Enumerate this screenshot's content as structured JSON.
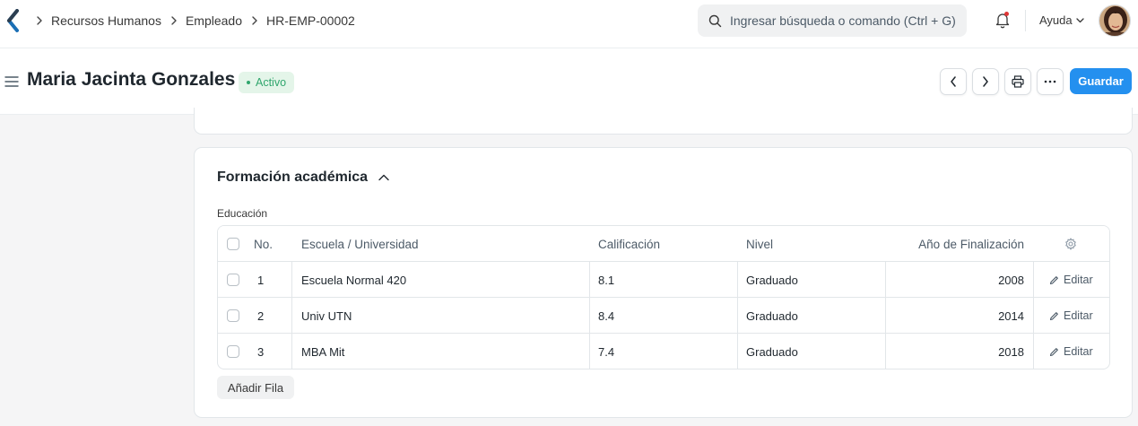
{
  "navbar": {
    "breadcrumbs": [
      "Recursos Humanos",
      "Empleado",
      "HR-EMP-00002"
    ],
    "search_placeholder": "Ingresar búsqueda o comando (Ctrl + G)",
    "help_label": "Ayuda",
    "icons": [
      "app-logo-icon",
      "chevron-right-icon",
      "search-icon",
      "bell-icon",
      "chevron-down-icon"
    ],
    "accent_color": "#2490ef",
    "notification_dot_color": "#e03636"
  },
  "page_head": {
    "title": "Maria Jacinta Gonzales",
    "status": "Activo",
    "status_color": "#30a66d",
    "save_label": "Guardar",
    "icons": [
      "hamburger-icon",
      "chevron-left-icon",
      "chevron-right-icon",
      "printer-icon",
      "more-icon"
    ]
  },
  "section": {
    "title": "Formación académica",
    "field_label": "Educación",
    "columns": {
      "no": "No.",
      "school": "Escuela / Universidad",
      "grade": "Calificación",
      "level": "Nivel",
      "year": "Año de Finalización"
    },
    "rows": [
      {
        "no": "1",
        "school": "Escuela Normal 420",
        "grade": "8.1",
        "level": "Graduado",
        "year": "2008",
        "action": "Editar"
      },
      {
        "no": "2",
        "school": "Univ UTN",
        "grade": "8.4",
        "level": "Graduado",
        "year": "2014",
        "action": "Editar"
      },
      {
        "no": "3",
        "school": "MBA Mit",
        "grade": "7.4",
        "level": "Graduado",
        "year": "2018",
        "action": "Editar"
      }
    ],
    "add_row_label": "Añadir Fila"
  }
}
